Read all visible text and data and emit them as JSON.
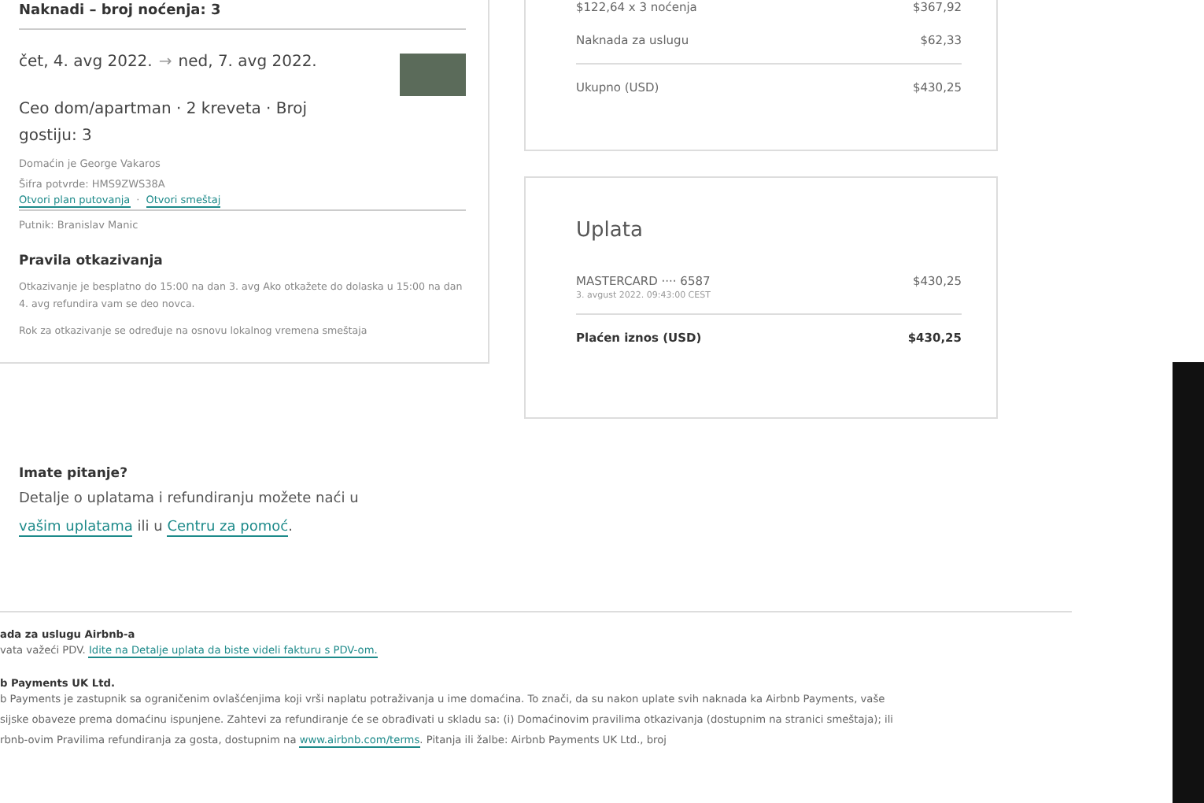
{
  "stay_card": {
    "heading": "Naknadi – broj noćenja: 3",
    "check_in": "čet, 4. avg 2022.",
    "arrow": "→",
    "check_out": "ned, 7. avg 2022.",
    "description": "Ceo dom/apartman · 2 kreveta · Broj gostiju: 3",
    "host": "Domaćin je George Vakaros",
    "confirmation": "Šifra potvrde: HMS9ZWS38A",
    "links": [
      "Otvori plan putovanja",
      "Otvori smeštaj"
    ],
    "link_separator": "·",
    "traveler": "Putnik: Branislav Manic",
    "policy_title": "Pravila otkazivanja",
    "policy_paragraphs": [
      "Otkazivanje je besplatno do 15:00 na dan 3. avg Ako otkažete do dolaska u 15:00 na dan 4. avg refundira vam se deo novca.",
      "Rok za otkazivanje se određuje na osnovu lokalnog vremena smeštaja"
    ]
  },
  "price_card": {
    "rows": [
      {
        "label": "$122,64 x 3 noćenja",
        "amount": "$367,92"
      },
      {
        "label": "Naknada za uslugu",
        "amount": "$62,33"
      }
    ],
    "total": {
      "label": "Ukupno (USD)",
      "amount": "$430,25"
    }
  },
  "payment_card": {
    "title": "Uplata",
    "method": "MASTERCARD ···· 6587",
    "amount": "$430,25",
    "date": "3. avgust 2022. 09:43:00 CEST",
    "paid_label": "Plaćen iznos (USD)",
    "paid_amount": "$430,25"
  },
  "question": {
    "title": "Imate pitanje?",
    "parts": [
      {
        "text": "Detalje o uplatama i refundiranju možete naći u ",
        "link": false
      },
      {
        "text": "vašim uplatama",
        "link": true
      },
      {
        "text": " ili u ",
        "link": false
      },
      {
        "text": "Centru za pomoć",
        "link": true
      },
      {
        "text": ".",
        "link": false
      }
    ]
  },
  "footer": {
    "sections": [
      {
        "title": "ada za uslugu Airbnb-a",
        "lines": [
          [
            {
              "text": "vata važeći PDV. ",
              "link": false
            },
            {
              "text": "Idite na Detalje uplata da biste videli fakturu s PDV-om.",
              "link": true
            }
          ]
        ]
      },
      {
        "title": "b Payments UK Ltd.",
        "lines": [
          [
            {
              "text": "b Payments je zastupnik sa ograničenim ovlašćenjima koji vrši naplatu potraživanja u ime domaćina. To znači, da su nakon uplate svih naknada ka Airbnb Payments, vaše",
              "link": false
            }
          ],
          [
            {
              "text": "sijske obaveze prema domaćinu ispunjene. Zahtevi za refundiranje će se obrađivati u skladu sa: (i) Domaćinovim pravilima otkazivanja (dostupnim na stranici smeštaja); ili",
              "link": false
            }
          ],
          [
            {
              "text": "rbnb-ovim Pravilima refundiranja za gosta, dostupnim na ",
              "link": false
            },
            {
              "text": "www.airbnb.com/terms",
              "link": true
            },
            {
              "text": ". Pitanja ili žalbe: Airbnb Payments UK Ltd., broj",
              "link": false
            }
          ]
        ]
      }
    ]
  }
}
